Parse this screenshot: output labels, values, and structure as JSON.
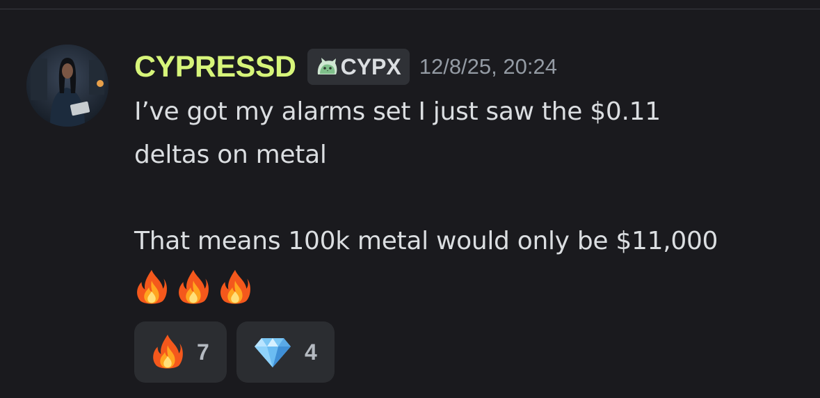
{
  "message": {
    "author": {
      "username": "CYPRESSD",
      "name_color": "#d7f57a",
      "avatar": "avatar-photo"
    },
    "tag": {
      "icon": "cat-tag-icon",
      "text": "CYPX"
    },
    "timestamp": "12/8/25, 20:24",
    "lines": [
      "I’ve got my alarms set I just saw the $0.11",
      "deltas on metal",
      "",
      "That means 100k metal would only be $11,000"
    ],
    "emojis": [
      "fire-icon",
      "fire-icon",
      "fire-icon"
    ]
  },
  "reactions": [
    {
      "icon": "fire-icon",
      "count": "7"
    },
    {
      "icon": "gem-icon",
      "count": "4"
    }
  ],
  "colors": {
    "background": "#1a1a1e",
    "text": "#dbdee1",
    "timestamp": "#949ba4",
    "reaction_bg": "#2b2d31"
  }
}
